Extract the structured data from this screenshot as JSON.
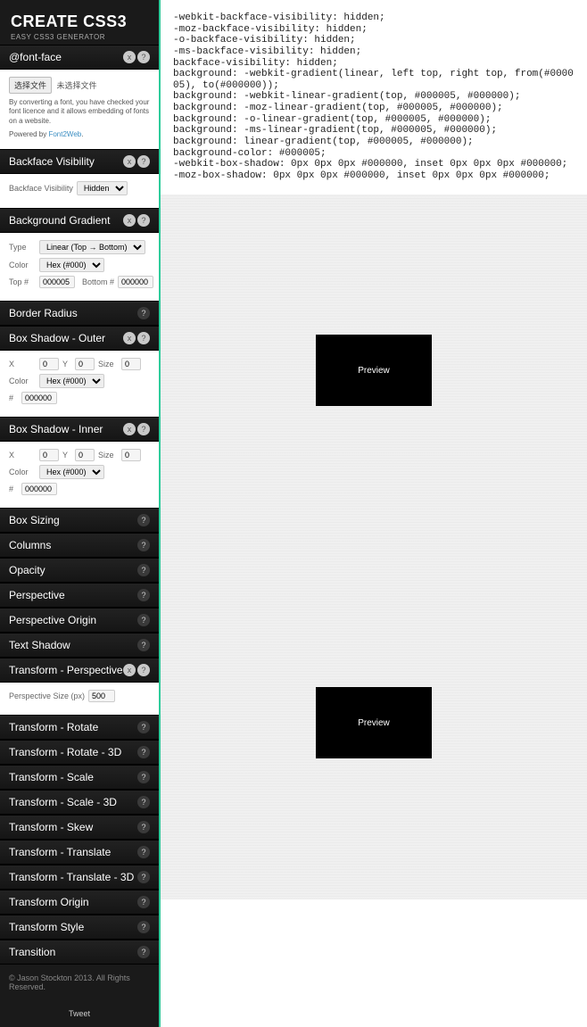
{
  "brand": {
    "title": "CREATE CSS3",
    "tagline": "EASY CSS3 GENERATOR"
  },
  "fontface": {
    "title": "@font-face",
    "button": "选择文件",
    "status": "未选择文件",
    "desc": "By converting a font, you have checked your font licence and it allows embedding of fonts on a website.",
    "powered": "Powered by ",
    "poweredLink": "Font2Web"
  },
  "backface": {
    "title": "Backface Visibility",
    "label": "Backface Visibility",
    "option": "Hidden"
  },
  "gradient": {
    "title": "Background Gradient",
    "typeLabel": "Type",
    "typeValue": "Linear (Top → Bottom)",
    "colorLabel": "Color",
    "colorValue": "Hex (#000)",
    "topLabel": "Top #",
    "topValue": "000005",
    "botLabel": "Bottom #",
    "botValue": "000000"
  },
  "borderRadius": {
    "title": "Border Radius"
  },
  "shadowOuter": {
    "title": "Box Shadow - Outer",
    "xLabel": "X",
    "xValue": "0",
    "yLabel": "Y",
    "yValue": "0",
    "sizeLabel": "Size",
    "sizeValue": "0",
    "colorLabel": "Color",
    "colorValue": "Hex (#000)",
    "hashLabel": "#",
    "hashValue": "000000"
  },
  "shadowInner": {
    "title": "Box Shadow - Inner",
    "xLabel": "X",
    "xValue": "0",
    "yLabel": "Y",
    "yValue": "0",
    "sizeLabel": "Size",
    "sizeValue": "0",
    "colorLabel": "Color",
    "colorValue": "Hex (#000)",
    "hashLabel": "#",
    "hashValue": "000000"
  },
  "sections": {
    "boxSizing": "Box Sizing",
    "columns": "Columns",
    "opacity": "Opacity",
    "perspective": "Perspective",
    "perspectiveOrigin": "Perspective Origin",
    "textShadow": "Text Shadow"
  },
  "transformPersp": {
    "title": "Transform - Perspective",
    "label": "Perspective Size (px)",
    "value": "500"
  },
  "sections2": {
    "transformRotate": "Transform - Rotate",
    "transformRotate3d": "Transform - Rotate - 3D",
    "transformScale": "Transform - Scale",
    "transformScale3d": "Transform - Scale - 3D",
    "transformSkew": "Transform - Skew",
    "transformTranslate": "Transform - Translate",
    "transformTranslate3d": "Transform - Translate - 3D",
    "transformOrigin": "Transform Origin",
    "transformStyle": "Transform Style",
    "transition": "Transition"
  },
  "footer": "© Jason Stockton 2013. All Rights Reserved.",
  "tweet": "Tweet",
  "preview": "Preview",
  "code": "-webkit-backface-visibility: hidden;\n-moz-backface-visibility: hidden;\n-o-backface-visibility: hidden;\n-ms-backface-visibility: hidden;\nbackface-visibility: hidden;\nbackground: -webkit-gradient(linear, left top, right top, from(#000005), to(#000000));\nbackground: -webkit-linear-gradient(top, #000005, #000000);\nbackground: -moz-linear-gradient(top, #000005, #000000);\nbackground: -o-linear-gradient(top, #000005, #000000);\nbackground: -ms-linear-gradient(top, #000005, #000000);\nbackground: linear-gradient(top, #000005, #000000);\nbackground-color: #000005;\n-webkit-box-shadow: 0px 0px 0px #000000, inset 0px 0px 0px #000000;\n-moz-box-shadow: 0px 0px 0px #000000, inset 0px 0px 0px #000000;"
}
